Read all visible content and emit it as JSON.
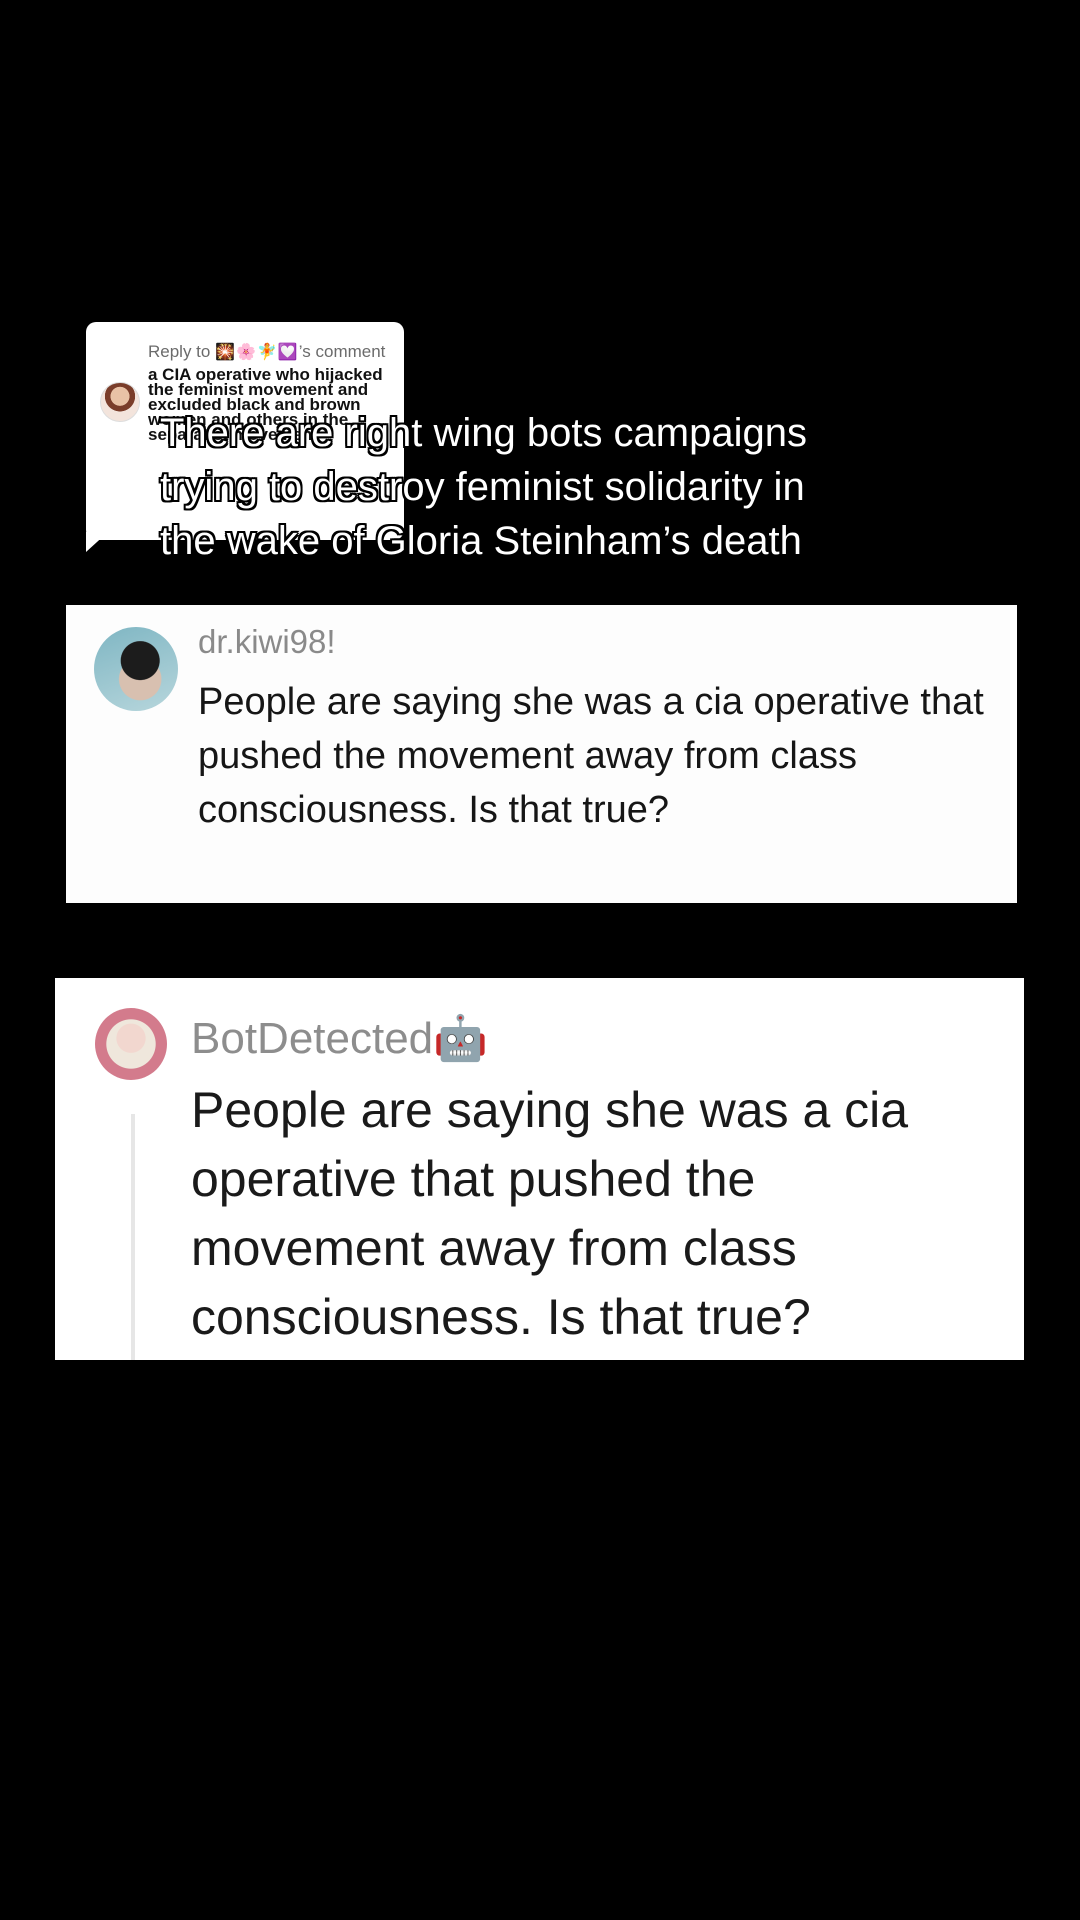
{
  "reply_sticker": {
    "prefix": "Reply to",
    "emojis": "🎇🌸🧚💟",
    "suffix": "’s comment",
    "text": "a CIA operative who hijacked the feminist movement and excluded black and brown women and others in the separatist movement"
  },
  "caption": {
    "line1": "There are right wing bots campaigns",
    "line2": "trying to destroy feminist solidarity in",
    "line3": "the wake of Gloria Steinham’s death"
  },
  "card1": {
    "username": "dr.kiwi98!",
    "text": "People are saying she was a cia operative that pushed the movement away from class consciousness. Is that true?"
  },
  "card2": {
    "username": "BotDetected🤖",
    "text": "People are saying she was a cia operative that pushed the movement away from class consciousness. Is that true?"
  }
}
